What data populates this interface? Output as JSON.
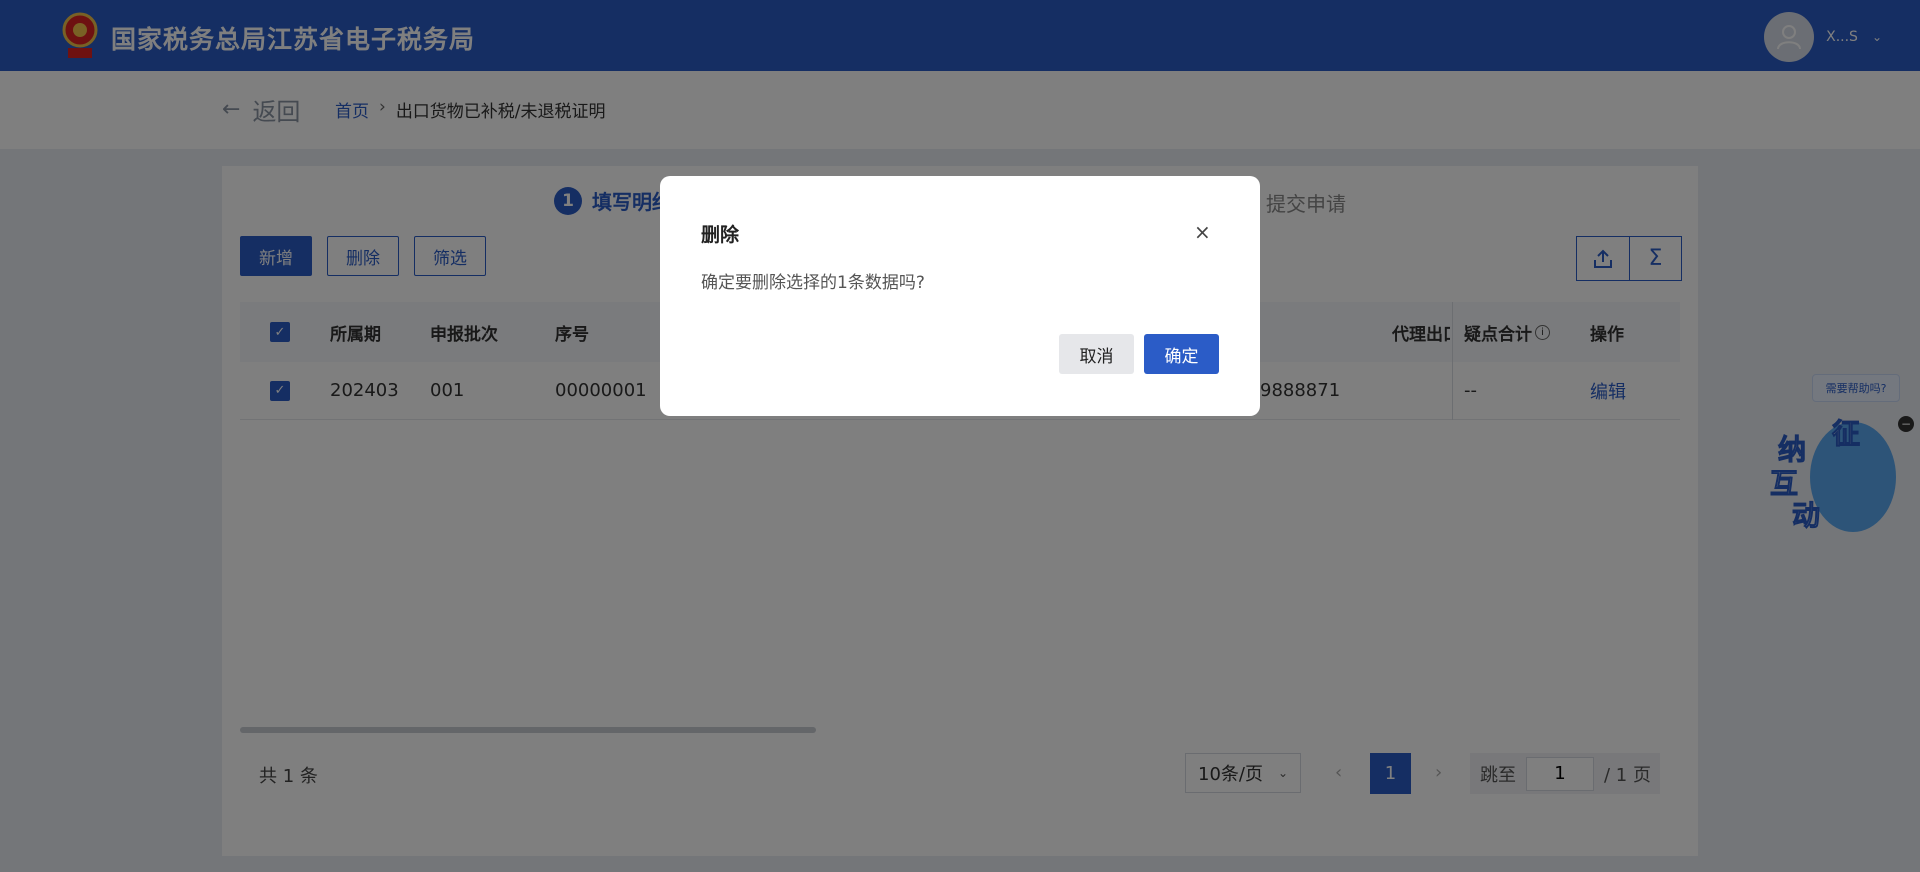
{
  "header": {
    "site_title": "国家税务总局江苏省电子税务局",
    "user_name": "X...S"
  },
  "nav": {
    "back_label": "返回",
    "breadcrumb_home": "首页",
    "breadcrumb_sep": "›",
    "breadcrumb_current": "出口货物已补税/未退税证明"
  },
  "steps": {
    "step1_num": "1",
    "step1_label": "填写明细",
    "step3_label": "提交申请"
  },
  "toolbar": {
    "add_label": "新增",
    "delete_label": "删除",
    "filter_label": "筛选"
  },
  "table": {
    "headers": {
      "period": "所属期",
      "batch": "申报批次",
      "seq": "序号",
      "agent": "代理出口",
      "doubt_total": "疑点合计",
      "action": "操作"
    },
    "rows": [
      {
        "period": "202403",
        "batch": "001",
        "seq": "00000001",
        "agent_partial": "9888871",
        "doubt_total": "--",
        "action": "编辑"
      }
    ]
  },
  "footer": {
    "total": "共 1 条",
    "page_size": "10条/页",
    "current_page": "1",
    "jump_label": "跳至",
    "jump_value": "1",
    "page_count": "/ 1 页"
  },
  "helper": {
    "bubble": "需要帮助吗?",
    "chars": [
      "征",
      "纳",
      "互",
      "动"
    ]
  },
  "dialog": {
    "title": "删除",
    "close": "×",
    "message": "确定要删除选择的1条数据吗?",
    "cancel_label": "取消",
    "ok_label": "确定"
  },
  "colors": {
    "primary": "#2b5cc7",
    "header_bg": "#2b5cc7"
  }
}
